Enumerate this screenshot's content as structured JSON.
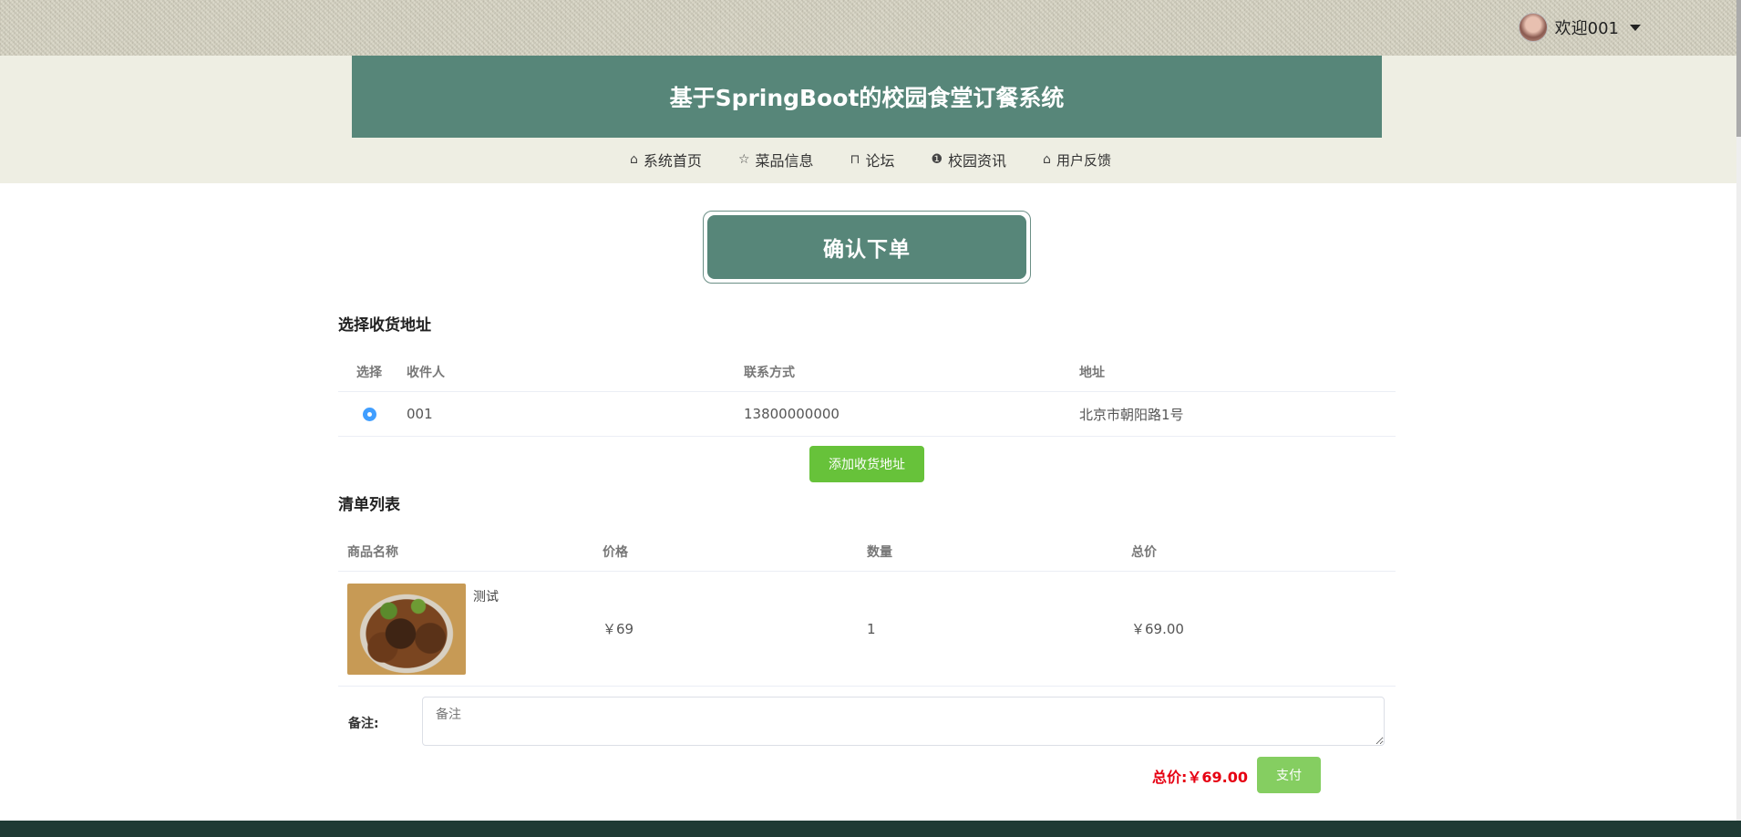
{
  "user": {
    "greeting": "欢迎001"
  },
  "header": {
    "title": "基于SpringBoot的校园食堂订餐系统"
  },
  "nav": [
    {
      "icon": "home-icon",
      "glyph": "⌂",
      "label": "系统首页"
    },
    {
      "icon": "star-icon",
      "glyph": "☆",
      "label": "菜品信息"
    },
    {
      "icon": "bag-icon",
      "glyph": "⊓",
      "label": "论坛"
    },
    {
      "icon": "info-icon",
      "glyph": "❶",
      "label": "校园资讯"
    },
    {
      "icon": "home-icon",
      "glyph": "⌂",
      "label": "用户反馈"
    }
  ],
  "confirm": {
    "title": "确认下单"
  },
  "address": {
    "section_title": "选择收货地址",
    "headers": [
      "选择",
      "收件人",
      "联系方式",
      "地址"
    ],
    "rows": [
      {
        "name": "001",
        "phone": "13800000000",
        "addr": "北京市朝阳路1号",
        "selected": true
      }
    ],
    "add_button": "添加收货地址"
  },
  "order": {
    "section_title": "清单列表",
    "headers": [
      "商品名称",
      "价格",
      "数量",
      "总价"
    ],
    "rows": [
      {
        "name": "测试",
        "price": "￥69",
        "qty": "1",
        "total": "￥69.00"
      }
    ]
  },
  "remark": {
    "label": "备注:",
    "placeholder": "备注"
  },
  "summary": {
    "total_label": "总价:￥69.00",
    "pay_button": "支付"
  },
  "colors": {
    "primary": "#578679",
    "accent_green": "#67c23a",
    "price_red": "#e60012",
    "footer": "#1f3a34"
  }
}
